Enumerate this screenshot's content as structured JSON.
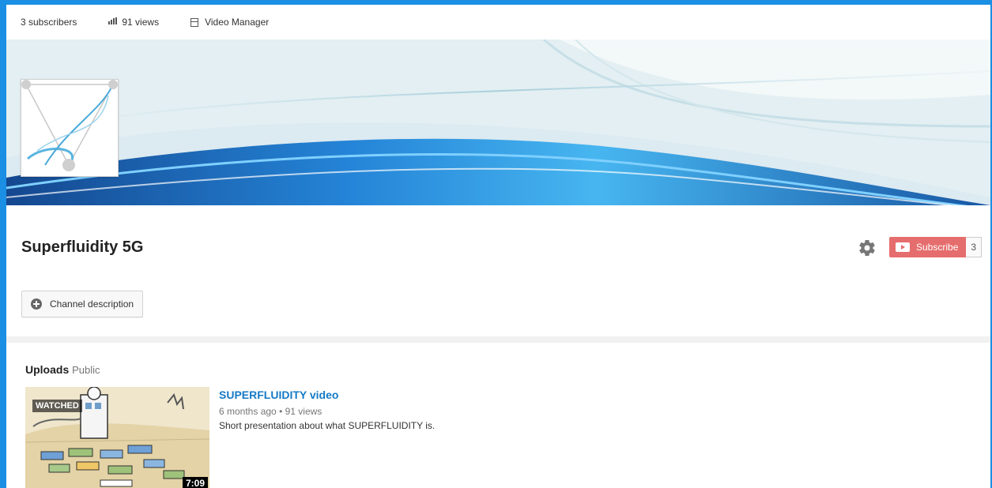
{
  "stats": {
    "subscribers": "3 subscribers",
    "views": "91 views",
    "video_manager": "Video Manager"
  },
  "channel": {
    "name": "Superfluidity 5G",
    "subscribe_label": "Subscribe",
    "subscriber_count": "3",
    "description_button": "Channel description"
  },
  "uploads": {
    "heading": "Uploads",
    "visibility": "Public",
    "videos": [
      {
        "title": "SUPERFLUIDITY video",
        "age": "6 months ago",
        "separator": "•",
        "views": "91 views",
        "description": "Short presentation about what SUPERFLUIDITY is.",
        "duration": "7:09",
        "watched_badge": "WATCHED"
      }
    ]
  },
  "colors": {
    "frame_border": "#1a8fe3",
    "subscribe": "#e66d6d",
    "link": "#167ac6"
  },
  "icons": {
    "views": "bar-chart-icon",
    "video_manager": "video-manager-icon",
    "settings": "gear-icon",
    "subscribe": "youtube-play-icon",
    "description": "plus-circle-icon"
  }
}
